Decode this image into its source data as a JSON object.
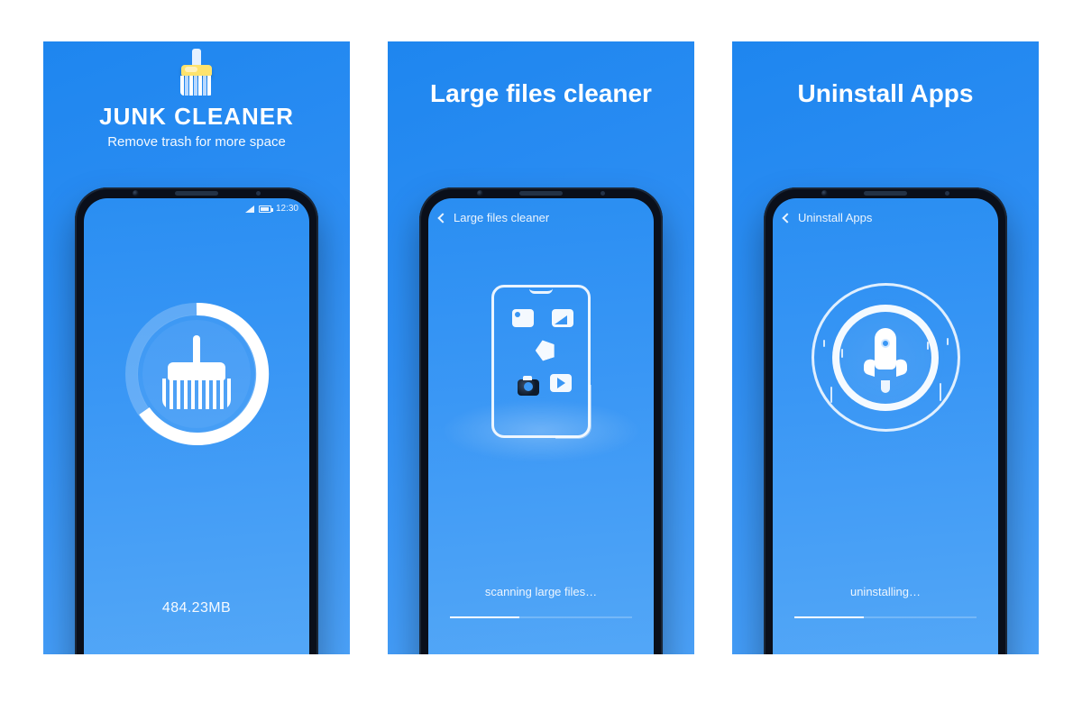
{
  "panels": [
    {
      "title": "JUNK CLEANER",
      "subtitle": "Remove trash for more space",
      "phone": {
        "status_time": "12:30",
        "scan_size": "484.23MB"
      }
    },
    {
      "title": "Large files cleaner",
      "phone": {
        "nav_label": "Large files cleaner",
        "status_text": "scanning large files…"
      }
    },
    {
      "title": "Uninstall Apps",
      "phone": {
        "nav_label": "Uninstall Apps",
        "status_text": "uninstalling…"
      }
    }
  ],
  "colors": {
    "brand_blue": "#2f8ff4",
    "accent_yellow": "#ffe36d"
  }
}
